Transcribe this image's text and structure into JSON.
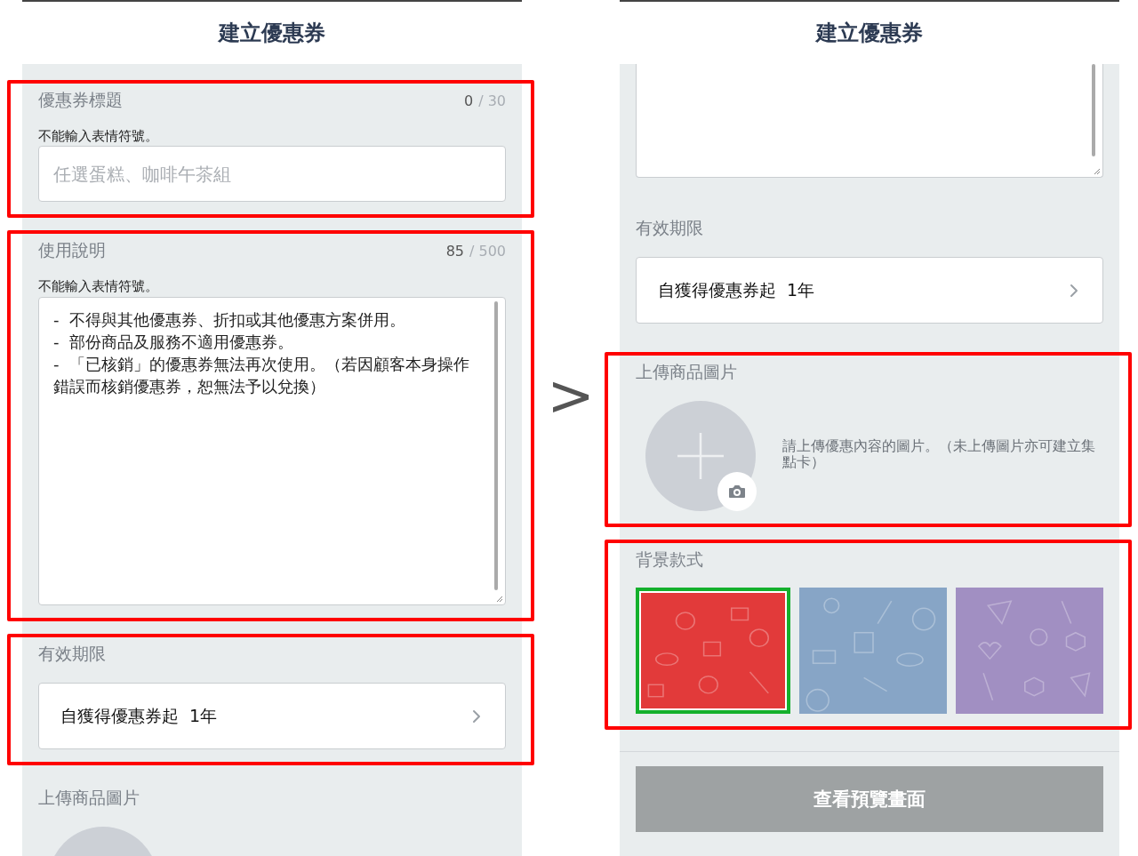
{
  "panels": [
    {
      "title": "建立優惠券",
      "sections": [
        {
          "kind": "text_input",
          "highlighted": true,
          "label": "優惠券標題",
          "count": "0",
          "limit": "/ 30",
          "hint": "不能輸入表情符號。",
          "placeholder": "任選蛋糕、咖啡午茶組"
        },
        {
          "kind": "textarea",
          "highlighted": true,
          "label": "使用說明",
          "count": "85",
          "limit": "/ 500",
          "hint": "不能輸入表情符號。",
          "value": "-  不得與其他優惠券、折扣或其他優惠方案併用。\n-  部份商品及服務不適用優惠券。\n-  「已核銷」的優惠券無法再次使用。（若因顧客本身操作錯誤而核銷優惠券，恕無法予以兌換）"
        },
        {
          "kind": "select",
          "highlighted": true,
          "label": "有效期限",
          "value": "自獲得優惠券起  1年"
        },
        {
          "kind": "upload",
          "highlighted": false,
          "label": "上傳商品圖片"
        }
      ]
    },
    {
      "title": "建立優惠券",
      "sections": [
        {
          "kind": "textarea_end",
          "highlighted": false
        },
        {
          "kind": "select",
          "highlighted": false,
          "label": "有效期限",
          "value": "自獲得優惠券起  1年"
        },
        {
          "kind": "upload",
          "highlighted": true,
          "label": "上傳商品圖片",
          "hint": "請上傳優惠內容的圖片。（未上傳圖片亦可建立集點卡）"
        },
        {
          "kind": "swatches",
          "highlighted": true,
          "label": "背景款式",
          "swatches": [
            {
              "color": "#e23a3a",
              "selected": true
            },
            {
              "color": "#87a5c6",
              "selected": false
            },
            {
              "color": "#a18fc2",
              "selected": false
            }
          ]
        },
        {
          "kind": "button",
          "highlighted": false,
          "label": "查看預覽畫面"
        }
      ]
    }
  ],
  "arrow": ">"
}
